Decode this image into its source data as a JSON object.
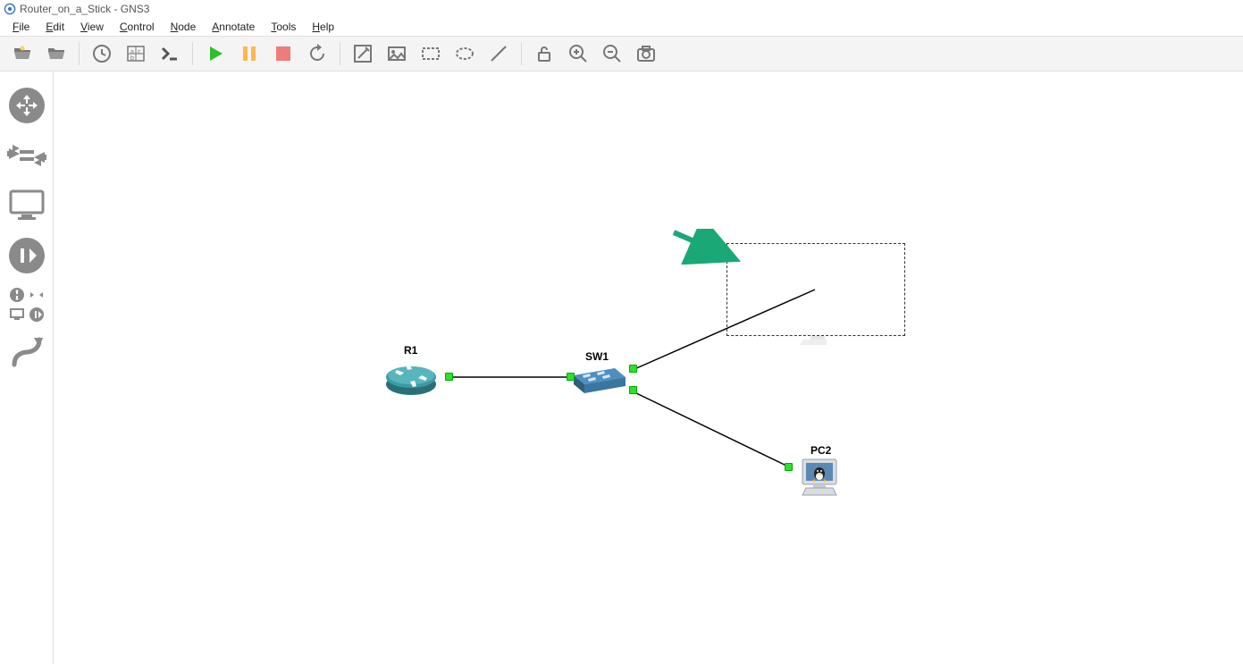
{
  "window": {
    "title": "Router_on_a_Stick - GNS3"
  },
  "menu": {
    "file": "File",
    "edit": "Edit",
    "view": "View",
    "control": "Control",
    "node": "Node",
    "annotate": "Annotate",
    "tools": "Tools",
    "help": "Help"
  },
  "toolbar_icons": {
    "open": "open-project-icon",
    "open2": "open-folder-icon",
    "clock": "snapshot-icon",
    "abc": "show-labels-icon",
    "console": "console-icon",
    "play": "play-icon",
    "pause": "pause-icon",
    "stop": "stop-icon",
    "reload": "reload-icon",
    "note": "add-note-icon",
    "image": "insert-image-icon",
    "rect": "draw-rectangle-icon",
    "ellipse": "draw-ellipse-icon",
    "line": "draw-line-icon",
    "lock": "lock-icon",
    "zoomin": "zoom-in-icon",
    "zoomout": "zoom-out-icon",
    "camera": "screenshot-icon"
  },
  "sidebar_icons": {
    "routers": "browse-routers-icon",
    "switches": "browse-switches-icon",
    "endhosts": "browse-end-devices-icon",
    "security": "browse-security-icon",
    "all": "browse-all-icon",
    "link": "add-link-icon"
  },
  "nodes": {
    "r1_label": "R1",
    "sw1_label": "SW1",
    "pc2_label": "PC2"
  }
}
